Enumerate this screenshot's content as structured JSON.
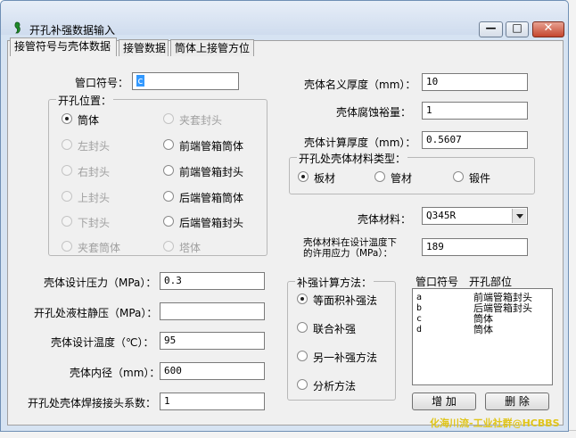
{
  "window": {
    "title": "开孔补强数据输入",
    "controls": {
      "minimize": "—",
      "maximize": "□",
      "close": "✕"
    }
  },
  "tabs": [
    {
      "label": "接管符号与壳体数据"
    },
    {
      "label": "接管数据"
    },
    {
      "label": "筒体上接管方位"
    }
  ],
  "left": {
    "nozzle_symbol": {
      "label": "管口符号：",
      "value": "c"
    },
    "position_group": {
      "title": "开孔位置：",
      "options": [
        {
          "label": "筒体"
        },
        {
          "label": "夹套封头"
        },
        {
          "label": "左封头"
        },
        {
          "label": "前端管箱筒体"
        },
        {
          "label": "右封头"
        },
        {
          "label": "前端管箱封头"
        },
        {
          "label": "上封头"
        },
        {
          "label": "后端管箱筒体"
        },
        {
          "label": "下封头"
        },
        {
          "label": "后端管箱封头"
        },
        {
          "label": "夹套筒体"
        },
        {
          "label": "塔体"
        }
      ]
    },
    "design_pressure": {
      "label": "壳体设计压力（MPa）：",
      "value": "0.3"
    },
    "liquid_pressure": {
      "label": "开孔处液柱静压（MPa）：",
      "value": ""
    },
    "design_temp": {
      "label": "壳体设计温度（℃）：",
      "value": "95"
    },
    "inner_diameter": {
      "label": "壳体内径（mm）：",
      "value": "600"
    },
    "weld_coefficient": {
      "label": "开孔处壳体焊接接头系数：",
      "value": "1"
    }
  },
  "right": {
    "nominal_thickness": {
      "label": "壳体名义厚度（mm）：",
      "value": "10"
    },
    "corrosion_allowance": {
      "label": "壳体腐蚀裕量：",
      "value": "1"
    },
    "calc_thickness": {
      "label": "壳体计算厚度（mm）：",
      "value": "0.5607"
    },
    "material_type_group": {
      "title": "开孔处壳体材料类型：",
      "options": [
        {
          "label": "板材"
        },
        {
          "label": "管材"
        },
        {
          "label": "锻件"
        }
      ]
    },
    "shell_material": {
      "label": "壳体材料：",
      "value": "Q345R"
    },
    "allowable_stress": {
      "label_line1": "壳体材料在设计温度下",
      "label_line2": "的许用应力（MPa）：",
      "value": "189"
    },
    "calc_method_group": {
      "title": "补强计算方法：",
      "options": [
        {
          "label": "等面积补强法"
        },
        {
          "label": "联合补强"
        },
        {
          "label": "另一补强方法"
        },
        {
          "label": "分析方法"
        }
      ]
    },
    "nozzle_list": {
      "headers": [
        "管口符号",
        "开孔部位"
      ],
      "rows": [
        {
          "symbol": "a",
          "location": "前端管箱封头"
        },
        {
          "symbol": "b",
          "location": "后端管箱封头"
        },
        {
          "symbol": "c",
          "location": "筒体"
        },
        {
          "symbol": "d",
          "location": "筒体"
        }
      ]
    },
    "add_button": "增 加",
    "delete_button": "删 除"
  },
  "watermark": "化海川流-工业社群@HCBBS",
  "colors": {
    "title_gradient_top": "#e7eef8",
    "close_button": "#c4452d",
    "selection": "#3399ff",
    "watermark": "#e0c51a"
  }
}
